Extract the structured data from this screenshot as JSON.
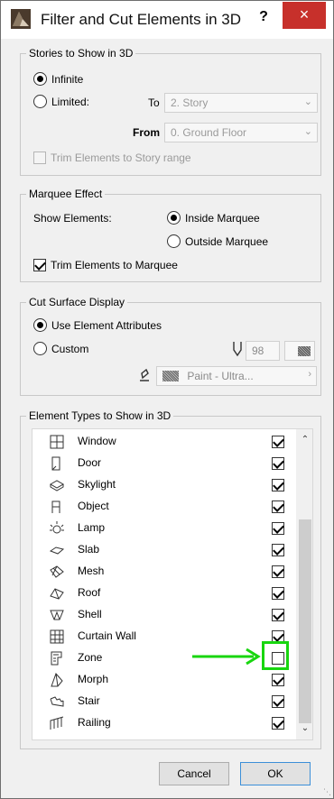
{
  "window": {
    "title": "Filter and Cut Elements in 3D",
    "help": "?",
    "close": "×"
  },
  "stories": {
    "title": "Stories to Show in 3D",
    "infinite": "Infinite",
    "limited": "Limited:",
    "to_label": "To",
    "to_value": "2. Story",
    "from_label": "From",
    "from_value": "0. Ground Floor",
    "trim": "Trim Elements to Story range"
  },
  "marquee": {
    "title": "Marquee Effect",
    "show_label": "Show Elements:",
    "inside": "Inside Marquee",
    "outside": "Outside Marquee",
    "trim": "Trim Elements to Marquee"
  },
  "cut": {
    "title": "Cut Surface Display",
    "use_attr": "Use Element Attributes",
    "custom": "Custom",
    "pen_value": "98",
    "paint": "Paint - Ultra..."
  },
  "types": {
    "title": "Element Types to Show in 3D",
    "items": [
      {
        "label": "Window",
        "icon": "window-icon",
        "checked": true
      },
      {
        "label": "Door",
        "icon": "door-icon",
        "checked": true
      },
      {
        "label": "Skylight",
        "icon": "skylight-icon",
        "checked": true
      },
      {
        "label": "Object",
        "icon": "object-icon",
        "checked": true
      },
      {
        "label": "Lamp",
        "icon": "lamp-icon",
        "checked": true
      },
      {
        "label": "Slab",
        "icon": "slab-icon",
        "checked": true
      },
      {
        "label": "Mesh",
        "icon": "mesh-icon",
        "checked": true
      },
      {
        "label": "Roof",
        "icon": "roof-icon",
        "checked": true
      },
      {
        "label": "Shell",
        "icon": "shell-icon",
        "checked": true
      },
      {
        "label": "Curtain Wall",
        "icon": "curtain-wall-icon",
        "checked": true
      },
      {
        "label": "Zone",
        "icon": "zone-icon",
        "checked": false
      },
      {
        "label": "Morph",
        "icon": "morph-icon",
        "checked": true
      },
      {
        "label": "Stair",
        "icon": "stair-icon",
        "checked": true
      },
      {
        "label": "Railing",
        "icon": "railing-icon",
        "checked": true
      }
    ]
  },
  "buttons": {
    "cancel": "Cancel",
    "ok": "OK"
  },
  "colors": {
    "close": "#c7302b",
    "highlight": "#18d60f"
  }
}
